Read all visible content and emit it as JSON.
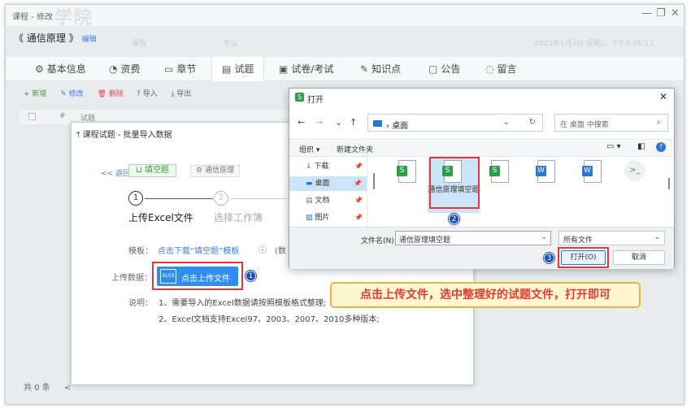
{
  "window": {
    "title": "课程 - 修改",
    "watermark": "学院"
  },
  "course": {
    "title": "《 通信原理 》",
    "edit": "编辑"
  },
  "bg": {
    "tab1": "课程",
    "tab2": "专业",
    "time": "2023年1月3日 星期二 下午5:06:13"
  },
  "tabs": [
    {
      "label": "基本信息",
      "icon": "gear-icon",
      "g": "⚙"
    },
    {
      "label": "资费",
      "icon": "coin-icon",
      "g": "◔"
    },
    {
      "label": "章节",
      "icon": "chapter-icon",
      "g": "▭"
    },
    {
      "label": "试题",
      "icon": "question-icon",
      "g": "▤"
    },
    {
      "label": "试卷/考试",
      "icon": "exam-icon",
      "g": "▣"
    },
    {
      "label": "知识点",
      "icon": "knowledge-icon",
      "g": "✎"
    },
    {
      "label": "公告",
      "icon": "notice-icon",
      "g": "▢"
    },
    {
      "label": "留言",
      "icon": "message-icon",
      "g": "◌"
    }
  ],
  "toolbar": {
    "add": "+ 新增",
    "edit": "✎ 修改",
    "del": "🗑 删除",
    "imp": "⤒ 导入",
    "exp": "⤓ 导出"
  },
  "table": {
    "hash": "#",
    "col": "试题"
  },
  "footer": {
    "total": "共 0 条",
    "prev": "<"
  },
  "panel": {
    "title": "课程试题 - 批量导入数据",
    "back": "返回",
    "type": "填空题",
    "course": "通信原理",
    "steps": [
      {
        "n": "1",
        "label": "上传Excel文件"
      },
      {
        "n": "2",
        "label": "选择工作簿"
      }
    ],
    "tpl_label": "模板：",
    "tpl_link": "点击下载“填空题”模板",
    "tpl_extra": "(数",
    "up_label": "上传数据：",
    "up_btn": "点击上传文件",
    "xlsx": "XLSX",
    "note_label": "说明：",
    "note1": "1、需要导入的Excel数据请按照模板格式整理;",
    "note2": "2、Excel文档支持Excel97、2003、2007、2010多种版本;"
  },
  "dialog": {
    "title": "打开",
    "path": "桌面",
    "search": "在 桌面 中搜索",
    "organize": "组织 ▾",
    "newfolder": "新建文件夹",
    "side": [
      {
        "label": "下载",
        "icon": "download-icon",
        "g": "↓",
        "c": "#2a78d4"
      },
      {
        "label": "桌面",
        "icon": "desktop-icon",
        "g": "▬",
        "c": "#2a78d4"
      },
      {
        "label": "文档",
        "icon": "document-icon",
        "g": "▤",
        "c": "#6a7f96"
      },
      {
        "label": "图片",
        "icon": "picture-icon",
        "g": "▨",
        "c": "#2a78d4"
      }
    ],
    "selected_file": "通信原理填空题",
    "fname_label": "文件名(N):",
    "fname": "通信原理填空题",
    "ftype": "所有文件",
    "open": "打开(O)",
    "cancel": "取消"
  },
  "markers": [
    "1",
    "2",
    "3"
  ],
  "callout": "点击上传文件，选中整理好的试题文件，打开即可"
}
